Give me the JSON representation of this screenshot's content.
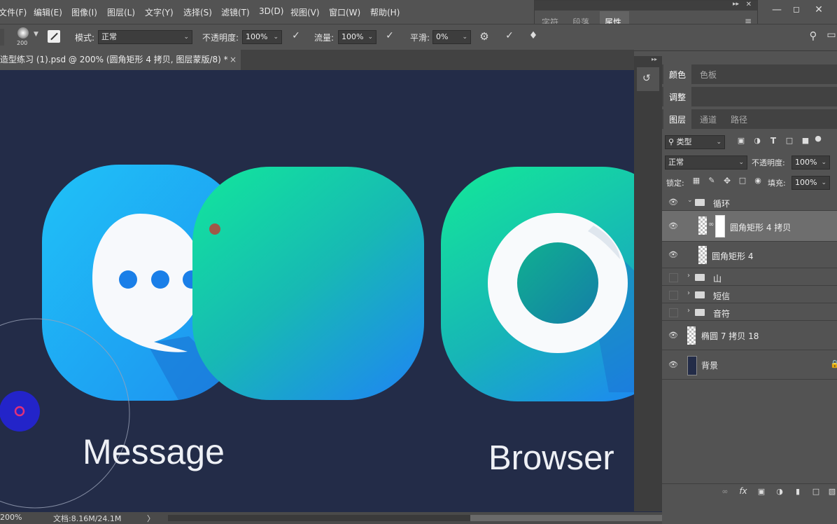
{
  "menu": [
    "文件(F)",
    "编辑(E)",
    "图像(I)",
    "图层(L)",
    "文字(Y)",
    "选择(S)",
    "滤镜(T)",
    "3D(D)",
    "视图(V)",
    "窗口(W)",
    "帮助(H)"
  ],
  "options": {
    "brush_size": "200",
    "mode_label": "模式:",
    "mode_value": "正常",
    "opacity_label": "不透明度:",
    "opacity_value": "100%",
    "flow_label": "流量:",
    "flow_value": "100%",
    "smooth_label": "平滑:",
    "smooth_value": "0%"
  },
  "doc_tab": {
    "title": "造型练习 (1).psd @ 200% (圆角矩形 4 拷贝, 图层蒙版/8) *",
    "close": "×"
  },
  "canvas": {
    "label_message": "Message",
    "label_browser": "Browser",
    "colors": {
      "bg": "#232c48",
      "blue": "#1e8ff0",
      "cyan": "#1ab8f5",
      "green": "#18e09a"
    }
  },
  "status": {
    "zoom": "200%",
    "doc": "文档:8.16M/24.1M",
    "arrow": "〉"
  },
  "floating_panel": {
    "tabs": [
      "字符",
      "段落",
      "属性"
    ],
    "active": 2
  },
  "right_panel": {
    "color_tabs": [
      "颜色",
      "色板"
    ],
    "adjust_tab": "调整",
    "layer_tabs": [
      "图层",
      "通道",
      "路径"
    ],
    "filter_kind": "类型",
    "blend_mode": "正常",
    "opacity_label": "不透明度:",
    "opacity_value": "100%",
    "lock_label": "锁定:",
    "fill_label": "填充:",
    "fill_value": "100%",
    "layers": [
      {
        "name": "循环",
        "type": "group-open",
        "visible": true
      },
      {
        "name": "圆角矩形 4 拷贝",
        "type": "layer-mask",
        "visible": true,
        "selected": true
      },
      {
        "name": "圆角矩形 4",
        "type": "layer",
        "visible": true
      },
      {
        "name": "山",
        "type": "group",
        "visible": false
      },
      {
        "name": "短信",
        "type": "group",
        "visible": false
      },
      {
        "name": "音符",
        "type": "group",
        "visible": false
      },
      {
        "name": "椭圆 7 拷贝 18",
        "type": "layer",
        "visible": true
      },
      {
        "name": "背景",
        "type": "background",
        "visible": true,
        "locked": true
      }
    ]
  }
}
